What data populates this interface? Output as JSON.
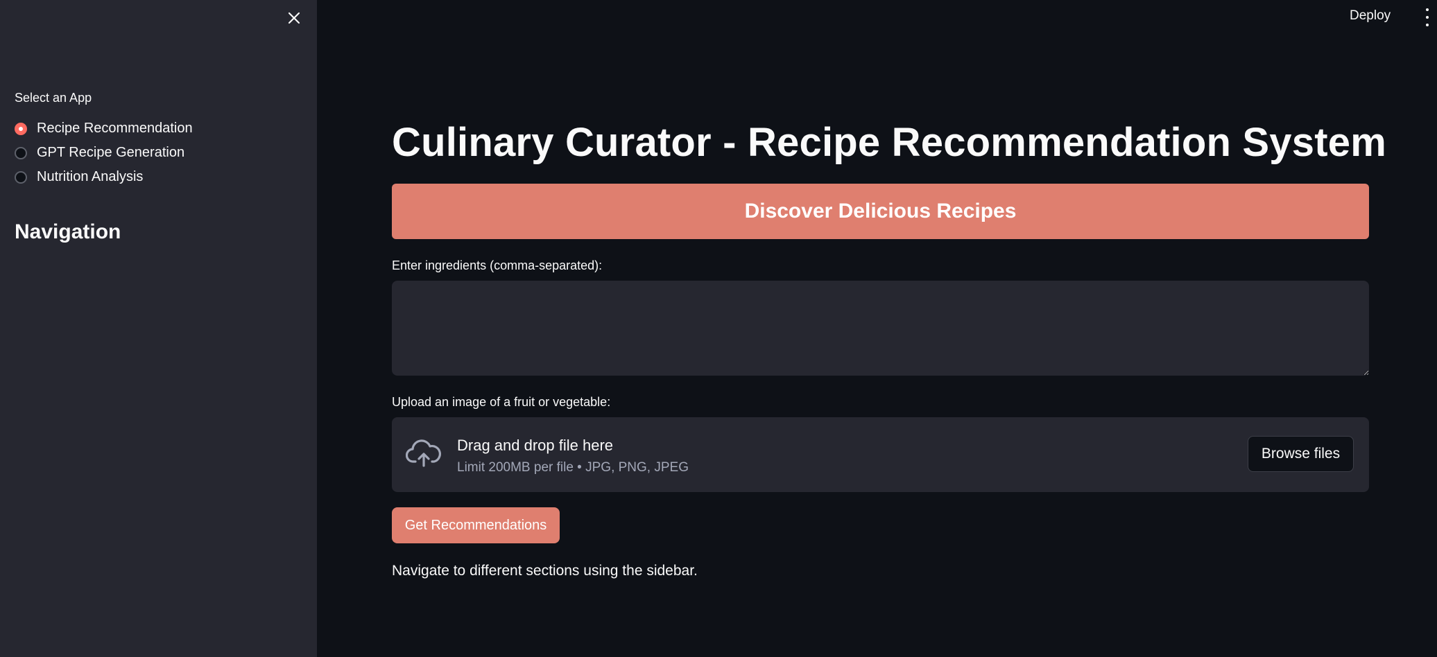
{
  "sidebar": {
    "select_label": "Select an App",
    "options": [
      {
        "label": "Recipe Recommendation",
        "checked": true
      },
      {
        "label": "GPT Recipe Generation",
        "checked": false
      },
      {
        "label": "Nutrition Analysis",
        "checked": false
      }
    ],
    "heading": "Navigation",
    "close_icon": "close-icon"
  },
  "topbar": {
    "deploy_label": "Deploy",
    "menu_icon": "kebab-menu-icon"
  },
  "main": {
    "title": "Culinary Curator - Recipe Recommendation System",
    "banner": "Discover Delicious Recipes",
    "ingredients_label": "Enter ingredients (comma-separated):",
    "ingredients_value": "",
    "upload_label": "Upload an image of a fruit or vegetable:",
    "dropzone": {
      "title": "Drag and drop file here",
      "subtitle": "Limit 200MB per file • JPG, PNG, JPEG",
      "browse_label": "Browse files",
      "icon": "cloud-upload-icon"
    },
    "submit_label": "Get Recommendations",
    "footer_text": "Navigate to different sections using the sidebar."
  },
  "colors": {
    "accent": "#df7f6f",
    "radio_checked": "#ff6b61",
    "background": "#0e1117",
    "sidebar_bg": "#262730"
  }
}
